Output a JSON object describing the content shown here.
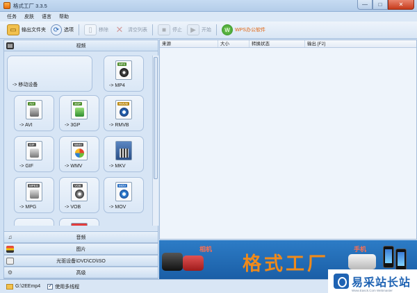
{
  "window": {
    "title": "格式工厂 3.3.5",
    "buttons": [
      "—",
      "□",
      "✕"
    ]
  },
  "menu": [
    "任务",
    "皮肤",
    "语言",
    "帮助"
  ],
  "toolbar": [
    {
      "label": "输出文件夹",
      "icon": "folder-icon",
      "enabled": true
    },
    {
      "label": "选项",
      "icon": "options-icon",
      "enabled": true
    },
    {
      "label": "移除",
      "icon": "remove-icon",
      "enabled": false
    },
    {
      "label": "清空列表",
      "icon": "clear-list-icon",
      "enabled": false
    },
    {
      "label": "停止",
      "icon": "stop-icon",
      "enabled": false
    },
    {
      "label": "开始",
      "icon": "start-icon",
      "enabled": false
    },
    {
      "label": "WPS办公软件",
      "icon": "wps-icon",
      "enabled": true
    }
  ],
  "left_panel": {
    "active_category": "视频",
    "tiles": [
      {
        "label": "-> 移动设备",
        "icon": ""
      },
      {
        "label": "-> MP4",
        "icon": "MP4"
      },
      {
        "label": "-> AVI",
        "icon": "AVI"
      },
      {
        "label": "-> 3GP",
        "icon": "3GP"
      },
      {
        "label": "-> RMVB",
        "icon": "RMVB"
      },
      {
        "label": "-> GIF",
        "icon": "GIF"
      },
      {
        "label": "-> WMV",
        "icon": "WMV"
      },
      {
        "label": "-> MKV",
        "icon": ""
      },
      {
        "label": "-> MPG",
        "icon": "MPEG"
      },
      {
        "label": "-> VOB",
        "icon": "VOB"
      },
      {
        "label": "-> MOV",
        "icon": "MOV"
      }
    ],
    "categories": [
      "音频",
      "图片",
      "光驱设备\\DVD\\CD\\ISO",
      "高级"
    ]
  },
  "task_table": {
    "columns": [
      "来源",
      "大小",
      "转换状态",
      "输出 [F2]"
    ]
  },
  "banner": {
    "title": "格式工厂",
    "tag_left": "相机",
    "tag_right": "手机"
  },
  "status": {
    "path": "G:\\2EEmp4",
    "multithread_label": "使用多线程",
    "multithread_checked": true
  },
  "watermark": {
    "text": "易采站长站",
    "sub": "Www.Easck.Com Webmaster"
  }
}
